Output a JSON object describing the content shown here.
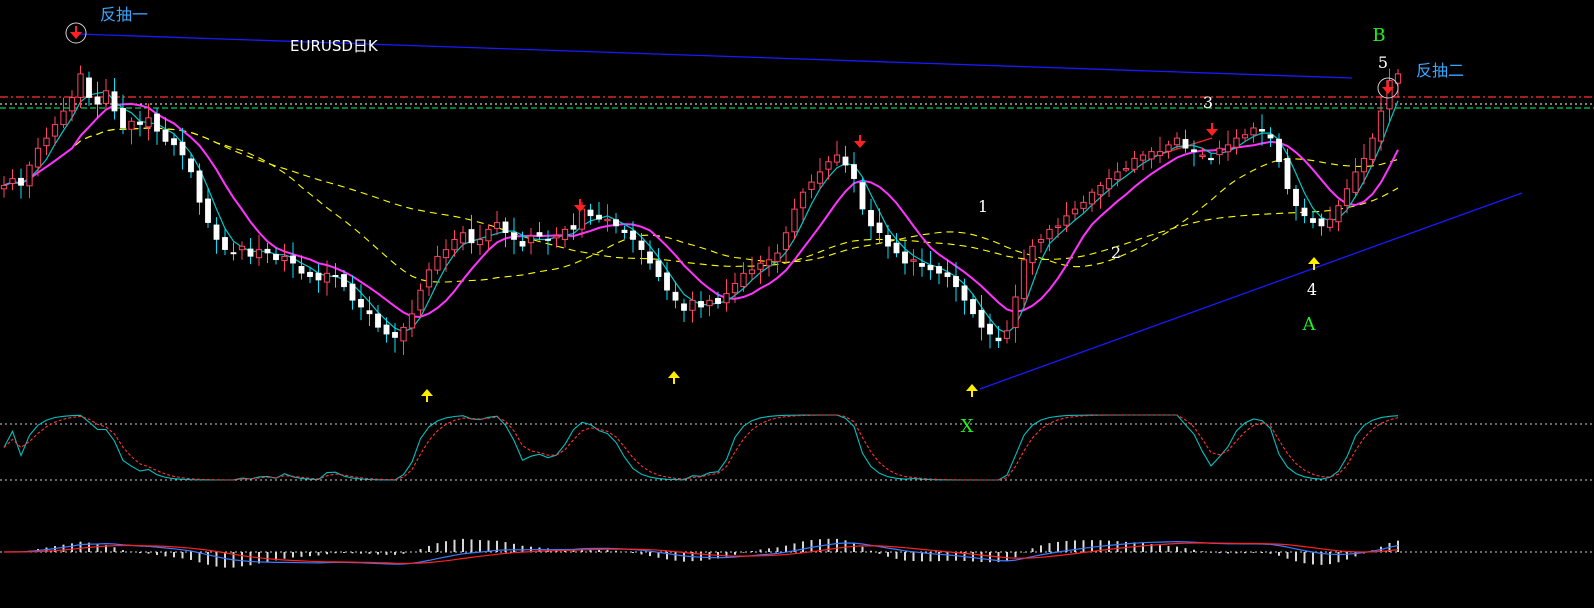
{
  "chart_data": {
    "type": "candlestick",
    "title": "EURUSD日K",
    "pattern_labels": {
      "wave_numbers": [
        "1",
        "2",
        "3",
        "4",
        "5"
      ],
      "points": [
        "X",
        "A",
        "B"
      ],
      "notes": [
        "反抽一",
        "反抽二"
      ]
    },
    "price_panel": {
      "price_range": [
        0,
        100
      ],
      "closes": [
        62,
        64,
        62,
        68,
        73,
        76,
        80,
        84,
        88,
        95,
        88,
        86,
        90,
        84,
        79,
        81,
        80,
        82,
        78,
        75,
        74,
        71,
        66,
        57,
        51,
        46,
        43,
        42,
        44,
        41,
        43,
        42,
        40,
        41,
        39,
        36,
        35,
        34,
        36,
        35,
        32,
        28,
        26,
        24,
        20,
        18,
        17,
        20,
        24,
        31,
        37,
        41,
        43,
        46,
        48,
        45,
        46,
        49,
        51,
        48,
        46,
        44,
        47,
        47,
        46,
        47,
        49,
        49,
        55,
        53,
        52,
        52,
        50,
        48,
        46,
        43,
        39,
        35,
        31,
        28,
        25,
        28,
        26,
        28,
        27,
        30,
        33,
        36,
        37,
        39,
        40,
        42,
        48,
        55,
        60,
        63,
        66,
        69,
        71,
        68,
        64,
        55,
        50,
        48,
        44,
        42,
        39,
        40,
        38,
        37,
        36,
        35,
        32,
        28,
        24,
        20,
        18,
        16,
        19,
        29,
        40,
        44,
        46,
        49,
        50,
        53,
        55,
        57,
        60,
        62,
        64,
        66,
        67,
        70,
        71,
        72,
        72,
        74,
        76,
        73,
        72,
        71,
        70,
        73,
        74,
        76,
        77,
        79,
        78,
        76,
        69,
        61,
        56,
        53,
        51,
        50,
        52,
        56,
        61,
        66,
        70,
        76,
        84,
        93,
        95
      ],
      "ma_colors": [
        "#00c8c8",
        "#ff33ff",
        "#ffff00",
        "#ffff00"
      ],
      "resistance_lines_color": [
        "#ff3333",
        "#00ff66",
        "#ffffff"
      ],
      "trendline_color": "#1a1aff"
    },
    "kdj_panel": {
      "line_colors": [
        "#00c0c0",
        "#ff3333"
      ],
      "levels": [
        80,
        20
      ]
    },
    "macd_panel": {
      "line_colors": [
        "#3a7bff",
        "#ff2222"
      ],
      "histogram_color": "#d8d8d8"
    }
  }
}
